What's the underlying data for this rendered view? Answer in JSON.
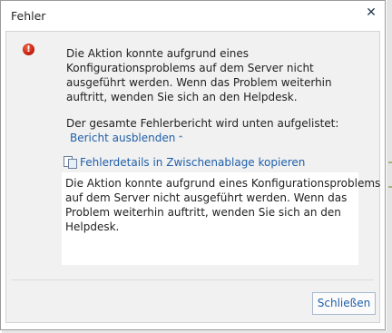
{
  "dialog": {
    "title": "Fehler",
    "close_glyph": "✕",
    "error_glyph": "!",
    "message_lines": [
      "Die Aktion konnte aufgrund eines",
      "Konfigurationsproblems auf dem Server nicht",
      "ausgeführt werden. Wenn das Problem weiterhin",
      "auftritt, wenden Sie sich an den Helpdesk."
    ],
    "report_summary": "Der gesamte Fehlerbericht wird unten aufgelistet:",
    "toggle_report_label": "Bericht ausblenden",
    "toggle_chevron": "⌃",
    "copy_details_label": "Fehlerdetails in Zwischenablage kopieren",
    "details_lines": [
      "Die Aktion konnte aufgrund eines Konfigurationsproblems",
      "auf dem Server nicht ausgeführt werden. Wenn das",
      "Problem weiterhin auftritt, wenden Sie sich an den",
      "Helpdesk."
    ],
    "close_button_label": "Schließen"
  },
  "colors": {
    "link": "#1f5fa9",
    "panel_background": "#f1f1f1",
    "error_red": "#c8200e"
  }
}
